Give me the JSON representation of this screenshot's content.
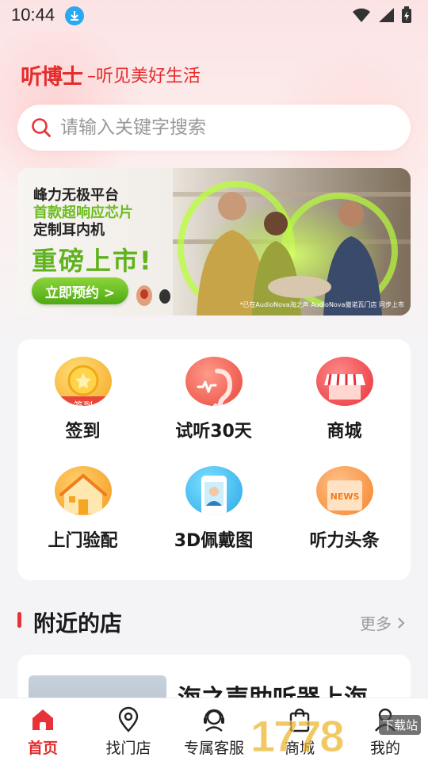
{
  "status_bar": {
    "time": "10:44"
  },
  "header": {
    "brand": "听博士",
    "slogan": "–听见美好生活"
  },
  "search": {
    "placeholder": "请输入关键字搜索"
  },
  "banner": {
    "line1": "峰力无极平台",
    "line2": "首款超响应芯片",
    "line3": "定制耳内机",
    "headline": "重磅上市!",
    "button": "立即预约 >",
    "note": "*已在AudioNova海之声 AudioNova傲诺瓦门店 同步上市"
  },
  "quick_actions": [
    {
      "label": "签到",
      "icon": "checkin-coin-icon",
      "badge": "签到"
    },
    {
      "label": "试听30天",
      "icon": "ear-icon"
    },
    {
      "label": "商城",
      "icon": "shop-awning-icon"
    },
    {
      "label": "上门验配",
      "icon": "house-icon"
    },
    {
      "label": "3D佩戴图",
      "icon": "phone-portrait-icon"
    },
    {
      "label": "听力头条",
      "icon": "news-icon",
      "badge": "NEWS"
    }
  ],
  "nearby": {
    "title": "附近的店",
    "more": "更多"
  },
  "store": {
    "name": "海之声助听器上海"
  },
  "bottom_nav": [
    {
      "label": "首页",
      "icon": "home-icon",
      "active": true
    },
    {
      "label": "找门店",
      "icon": "location-pin-icon"
    },
    {
      "label": "专属客服",
      "icon": "headset-icon"
    },
    {
      "label": "商城",
      "icon": "shopping-bag-icon"
    },
    {
      "label": "我的",
      "icon": "user-icon"
    }
  ],
  "watermark": {
    "text": "1778",
    "tag": "下载站"
  },
  "colors": {
    "accent": "#e52b2b",
    "banner_green": "#5fb31c"
  }
}
